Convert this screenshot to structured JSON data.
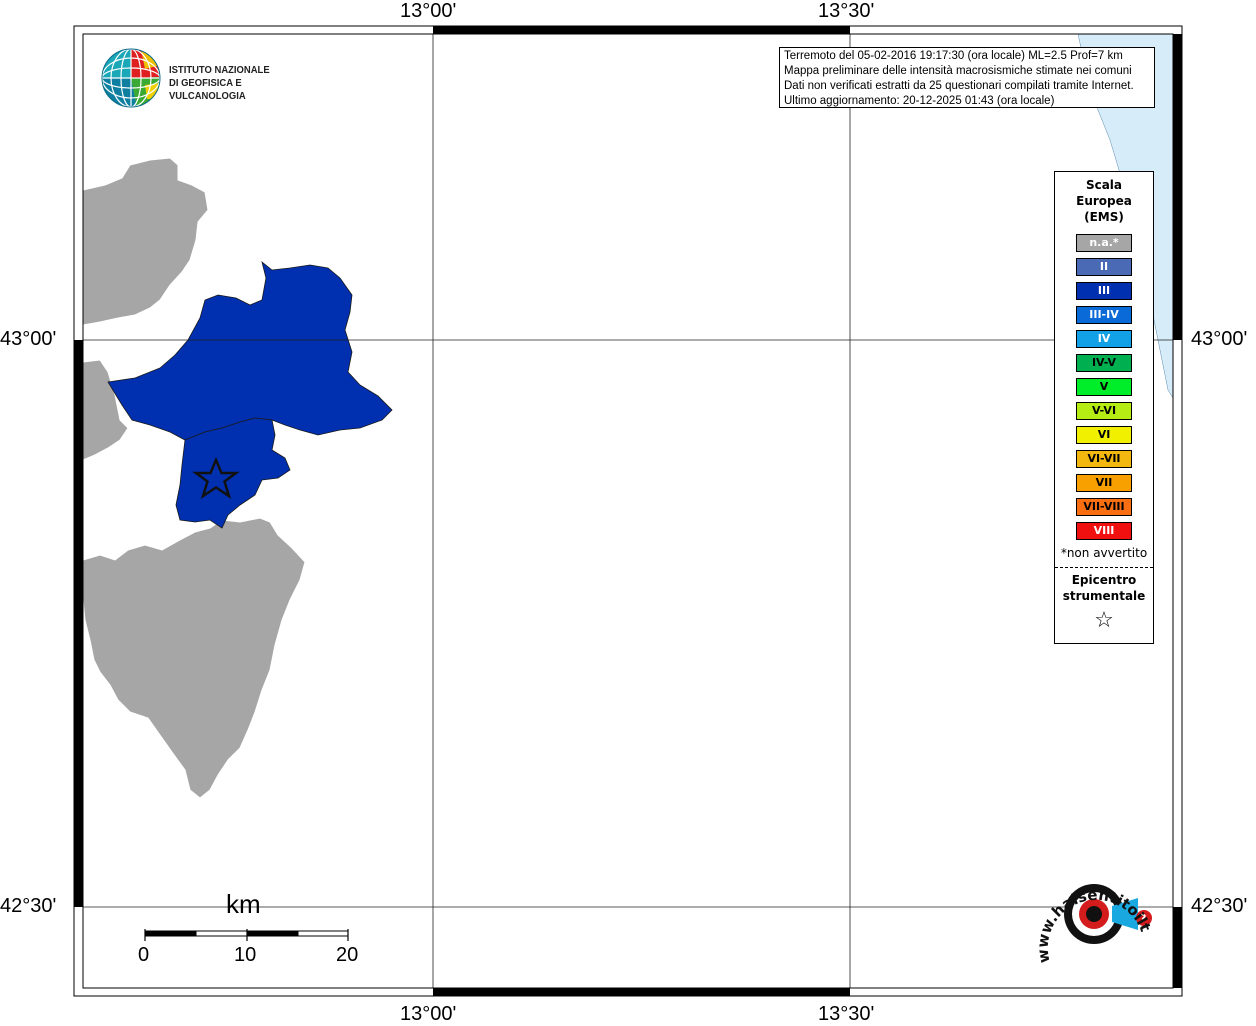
{
  "coordinates": {
    "top": [
      "13°00'",
      "13°30'"
    ],
    "bottom": [
      "13°00'",
      "13°30'"
    ],
    "left": [
      "43°00'",
      "42°30'"
    ],
    "right": [
      "43°00'",
      "42°30'"
    ]
  },
  "info": {
    "line1": "Terremoto del 05-02-2016 19:17:30 (ora locale) ML=2.5 Prof=7 km",
    "line2": "Mappa preliminare delle intensità macrosismiche stimate nei comuni",
    "line3": "Dati non verificati estratti da 25 questionari compilati tramite Internet.",
    "line4": "Ultimo aggiornamento: 20-12-2025 01:43 (ora locale)"
  },
  "logo": {
    "line1": "ISTITUTO NAZIONALE",
    "line2": "DI GEOFISICA E VULCANOLOGIA"
  },
  "legend": {
    "title1": "Scala",
    "title2": "Europea",
    "title3": "(EMS)",
    "items": [
      {
        "label": "n.a.*",
        "color": "#a6a6a6"
      },
      {
        "label": "II",
        "color": "#4a6ab5"
      },
      {
        "label": "III",
        "color": "#0030b0"
      },
      {
        "label": "III-IV",
        "color": "#0a6ad8"
      },
      {
        "label": "IV",
        "color": "#12a0e6"
      },
      {
        "label": "IV-V",
        "color": "#00b050"
      },
      {
        "label": "V",
        "color": "#00ee2a"
      },
      {
        "label": "V-VI",
        "color": "#b4ec14"
      },
      {
        "label": "VI",
        "color": "#f0f000"
      },
      {
        "label": "VI-VII",
        "color": "#f2b810"
      },
      {
        "label": "VII",
        "color": "#f8a000"
      },
      {
        "label": "VII-VIII",
        "color": "#f86e10"
      },
      {
        "label": "VIII",
        "color": "#f01010"
      }
    ],
    "note": "*non avvertito",
    "epicentre1": "Epicentro",
    "epicentre2": "strumentale",
    "star": "☆"
  },
  "scalebar": {
    "unit": "km",
    "ticks": [
      "0",
      "10",
      "20"
    ]
  },
  "watermark": {
    "text": "www.haisentitoilterremoto.it"
  },
  "colors": {
    "na": "#a6a6a6",
    "intensity_III": "#0030b0",
    "sea": "#d6ecf8"
  }
}
